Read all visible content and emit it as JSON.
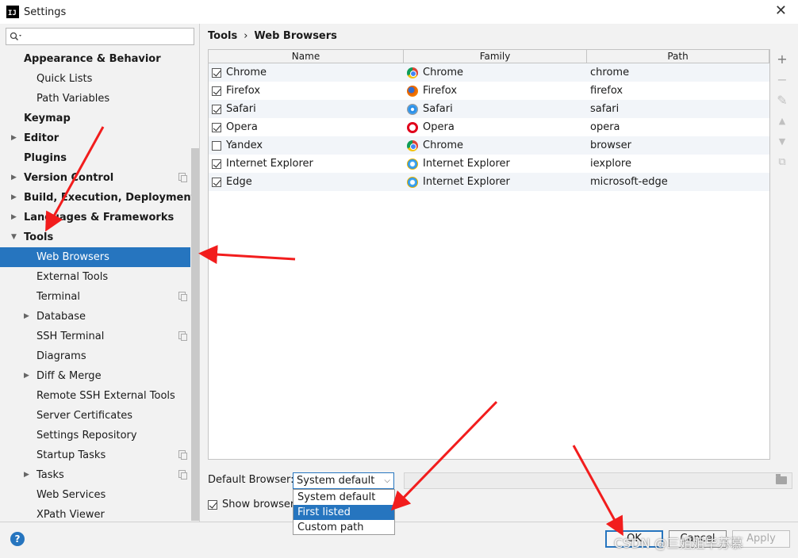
{
  "window": {
    "title": "Settings",
    "logo_text": "IJ",
    "close_glyph": "✕"
  },
  "search": {
    "icon": "search-icon",
    "value": ""
  },
  "sidebar": {
    "items": [
      {
        "label": "Appearance & Behavior",
        "bold": true,
        "level": 1,
        "arrow": ""
      },
      {
        "label": "Quick Lists",
        "bold": false,
        "level": 2,
        "arrow": ""
      },
      {
        "label": "Path Variables",
        "bold": false,
        "level": 2,
        "arrow": ""
      },
      {
        "label": "Keymap",
        "bold": true,
        "level": 1,
        "arrow": ""
      },
      {
        "label": "Editor",
        "bold": true,
        "level": 1,
        "arrow": "right"
      },
      {
        "label": "Plugins",
        "bold": true,
        "level": 1,
        "arrow": ""
      },
      {
        "label": "Version Control",
        "bold": true,
        "level": 1,
        "arrow": "right",
        "copy": true
      },
      {
        "label": "Build, Execution, Deployment",
        "bold": true,
        "level": 1,
        "arrow": "right"
      },
      {
        "label": "Languages & Frameworks",
        "bold": true,
        "level": 1,
        "arrow": "right"
      },
      {
        "label": "Tools",
        "bold": true,
        "level": 1,
        "arrow": "down"
      },
      {
        "label": "Web Browsers",
        "bold": false,
        "level": 2,
        "arrow": "",
        "selected": true
      },
      {
        "label": "External Tools",
        "bold": false,
        "level": 2,
        "arrow": ""
      },
      {
        "label": "Terminal",
        "bold": false,
        "level": 2,
        "arrow": "",
        "copy": true
      },
      {
        "label": "Database",
        "bold": false,
        "level": 2,
        "arrow": "right"
      },
      {
        "label": "SSH Terminal",
        "bold": false,
        "level": 2,
        "arrow": "",
        "copy": true
      },
      {
        "label": "Diagrams",
        "bold": false,
        "level": 2,
        "arrow": ""
      },
      {
        "label": "Diff & Merge",
        "bold": false,
        "level": 2,
        "arrow": "right"
      },
      {
        "label": "Remote SSH External Tools",
        "bold": false,
        "level": 2,
        "arrow": ""
      },
      {
        "label": "Server Certificates",
        "bold": false,
        "level": 2,
        "arrow": ""
      },
      {
        "label": "Settings Repository",
        "bold": false,
        "level": 2,
        "arrow": ""
      },
      {
        "label": "Startup Tasks",
        "bold": false,
        "level": 2,
        "arrow": "",
        "copy": true
      },
      {
        "label": "Tasks",
        "bold": false,
        "level": 2,
        "arrow": "right",
        "copy": true
      },
      {
        "label": "Web Services",
        "bold": false,
        "level": 2,
        "arrow": ""
      },
      {
        "label": "XPath Viewer",
        "bold": false,
        "level": 2,
        "arrow": ""
      }
    ]
  },
  "breadcrumb": {
    "parent": "Tools",
    "separator": "›",
    "current": "Web Browsers"
  },
  "table": {
    "columns": [
      "Name",
      "Family",
      "Path"
    ],
    "rows": [
      {
        "checked": true,
        "name": "Chrome",
        "family": "Chrome",
        "family_icon": "chrome-icon",
        "path": "chrome"
      },
      {
        "checked": true,
        "name": "Firefox",
        "family": "Firefox",
        "family_icon": "firefox-icon",
        "path": "firefox"
      },
      {
        "checked": true,
        "name": "Safari",
        "family": "Safari",
        "family_icon": "safari-icon",
        "path": "safari"
      },
      {
        "checked": true,
        "name": "Opera",
        "family": "Opera",
        "family_icon": "opera-icon",
        "path": "opera"
      },
      {
        "checked": false,
        "name": "Yandex",
        "family": "Chrome",
        "family_icon": "chrome-icon",
        "path": "browser"
      },
      {
        "checked": true,
        "name": "Internet Explorer",
        "family": "Internet Explorer",
        "family_icon": "ie-icon",
        "path": "iexplore"
      },
      {
        "checked": true,
        "name": "Edge",
        "family": "Internet Explorer",
        "family_icon": "ie-icon",
        "path": "microsoft-edge"
      }
    ]
  },
  "toolbar": {
    "add": "+",
    "remove": "−",
    "edit": "✎",
    "up": "▲",
    "down": "▼",
    "copy": "⧉"
  },
  "default_browser": {
    "label": "Default Browser:",
    "selected": "System default",
    "options": [
      "System default",
      "First listed",
      "Custom path"
    ],
    "highlighted": "First listed",
    "path_value": ""
  },
  "show_browser": {
    "label": "Show browser",
    "checked": true
  },
  "footer": {
    "help": "?",
    "ok": "OK",
    "cancel": "Cancel",
    "apply": "Apply"
  },
  "watermark": "CSDN @三姐姐毕苏慕",
  "colors": {
    "accent": "#2675bf",
    "annotation_red": "#f21d1d"
  }
}
